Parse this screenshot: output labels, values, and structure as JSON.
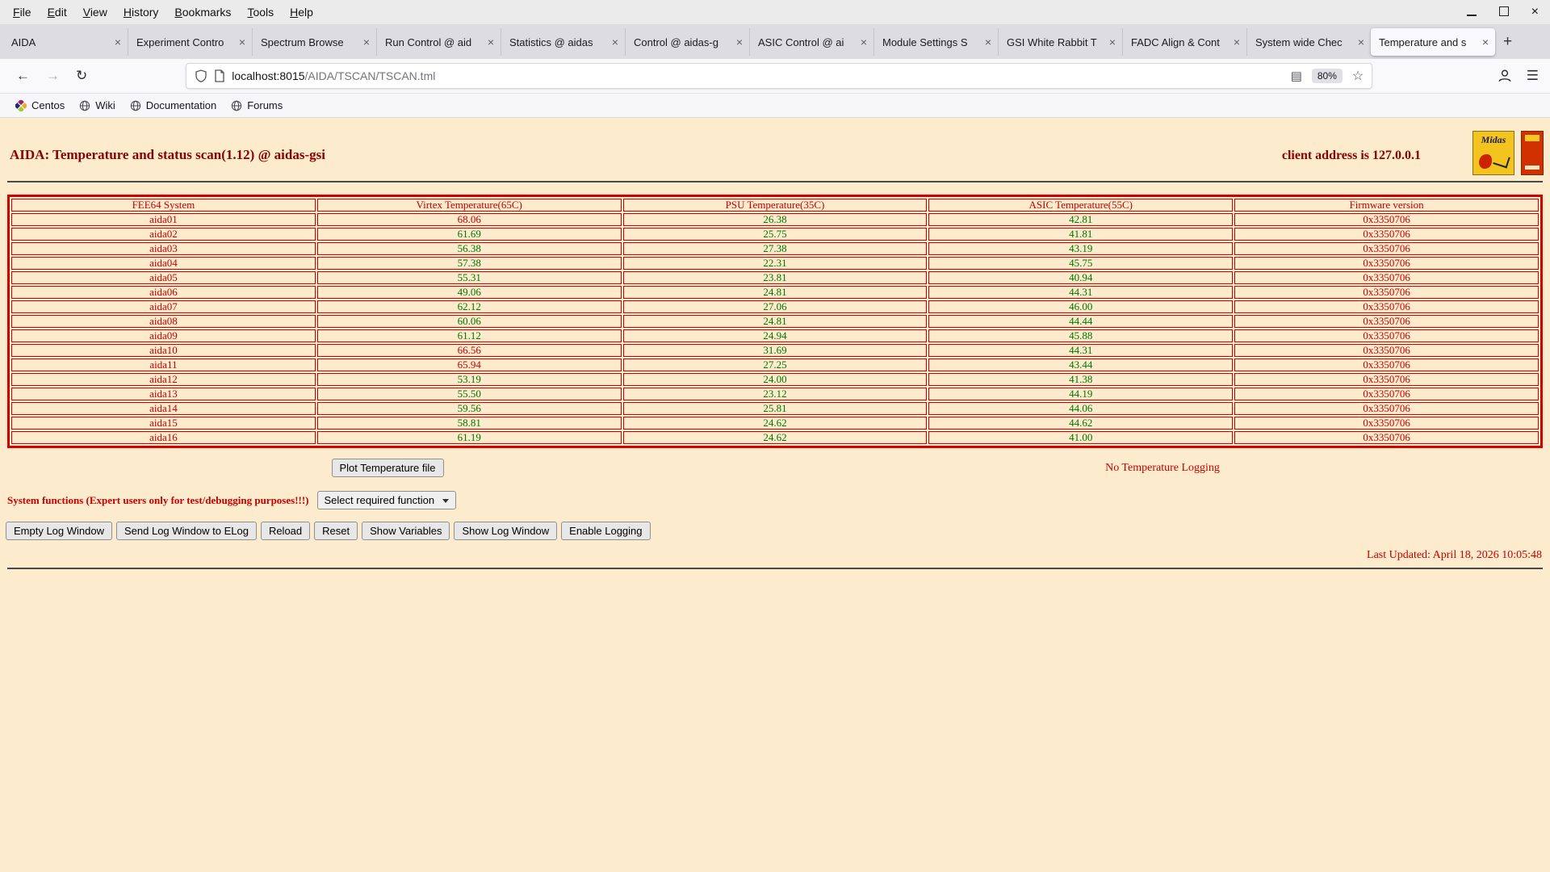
{
  "colors": {
    "page_bg": "#fcebcd",
    "maroon": "#8b0000",
    "red": "#c80000",
    "green": "#007700",
    "table_border": "#d40000"
  },
  "window": {
    "menu": [
      "File",
      "Edit",
      "View",
      "History",
      "Bookmarks",
      "Tools",
      "Help"
    ]
  },
  "tabs": {
    "items": [
      "AIDA",
      "Experiment Contro",
      "Spectrum Browse",
      "Run Control @ aid",
      "Statistics @ aidas",
      "Control @ aidas-g",
      "ASIC Control @ ai",
      "Module Settings S",
      "GSI White Rabbit T",
      "FADC Align & Cont",
      "System wide Chec",
      "Temperature and s"
    ],
    "active_index": 11
  },
  "toolbar": {
    "url_host": "localhost:8015",
    "url_path": "/AIDA/TSCAN/TSCAN.tml",
    "zoom": "80%"
  },
  "bookmarks": [
    "Centos",
    "Wiki",
    "Documentation",
    "Forums"
  ],
  "icons": {
    "back": "←",
    "forward": "→",
    "reload": "↻",
    "reader": "▤",
    "star": "☆",
    "menu": "☰",
    "new_tab": "+",
    "close": "×",
    "close_window": "×"
  },
  "page": {
    "title": "AIDA: Temperature and status scan(1.12) @ aidas-gsi",
    "client_address": "client address is 127.0.0.1",
    "logo_text": "Midas",
    "table": {
      "headers": [
        "FEE64 System",
        "Virtex Temperature(65C)",
        "PSU Temperature(35C)",
        "ASIC Temperature(55C)",
        "Firmware version"
      ],
      "thresholds": {
        "virtex": 65,
        "psu": 35,
        "asic": 55
      },
      "rows": [
        [
          "aida01",
          "68.06",
          "26.38",
          "42.81",
          "0x3350706"
        ],
        [
          "aida02",
          "61.69",
          "25.75",
          "41.81",
          "0x3350706"
        ],
        [
          "aida03",
          "56.38",
          "27.38",
          "43.19",
          "0x3350706"
        ],
        [
          "aida04",
          "57.38",
          "22.31",
          "45.75",
          "0x3350706"
        ],
        [
          "aida05",
          "55.31",
          "23.81",
          "40.94",
          "0x3350706"
        ],
        [
          "aida06",
          "49.06",
          "24.81",
          "44.31",
          "0x3350706"
        ],
        [
          "aida07",
          "62.12",
          "27.06",
          "46.00",
          "0x3350706"
        ],
        [
          "aida08",
          "60.06",
          "24.81",
          "44.44",
          "0x3350706"
        ],
        [
          "aida09",
          "61.12",
          "24.94",
          "45.88",
          "0x3350706"
        ],
        [
          "aida10",
          "66.56",
          "31.69",
          "44.31",
          "0x3350706"
        ],
        [
          "aida11",
          "65.94",
          "27.25",
          "43.44",
          "0x3350706"
        ],
        [
          "aida12",
          "53.19",
          "24.00",
          "41.38",
          "0x3350706"
        ],
        [
          "aida13",
          "55.50",
          "23.12",
          "44.19",
          "0x3350706"
        ],
        [
          "aida14",
          "59.56",
          "25.81",
          "44.06",
          "0x3350706"
        ],
        [
          "aida15",
          "58.81",
          "24.62",
          "44.62",
          "0x3350706"
        ],
        [
          "aida16",
          "61.19",
          "24.62",
          "41.00",
          "0x3350706"
        ]
      ]
    },
    "plot_button": "Plot Temperature file",
    "logging_status": "No Temperature Logging",
    "system_functions_label": "System functions (Expert users only for test/debugging purposes!!!)",
    "function_select": "Select required function",
    "action_buttons": [
      "Empty Log Window",
      "Send Log Window to ELog",
      "Reload",
      "Reset",
      "Show Variables",
      "Show Log Window",
      "Enable Logging"
    ],
    "last_updated": "Last Updated: April 18, 2026 10:05:48"
  }
}
